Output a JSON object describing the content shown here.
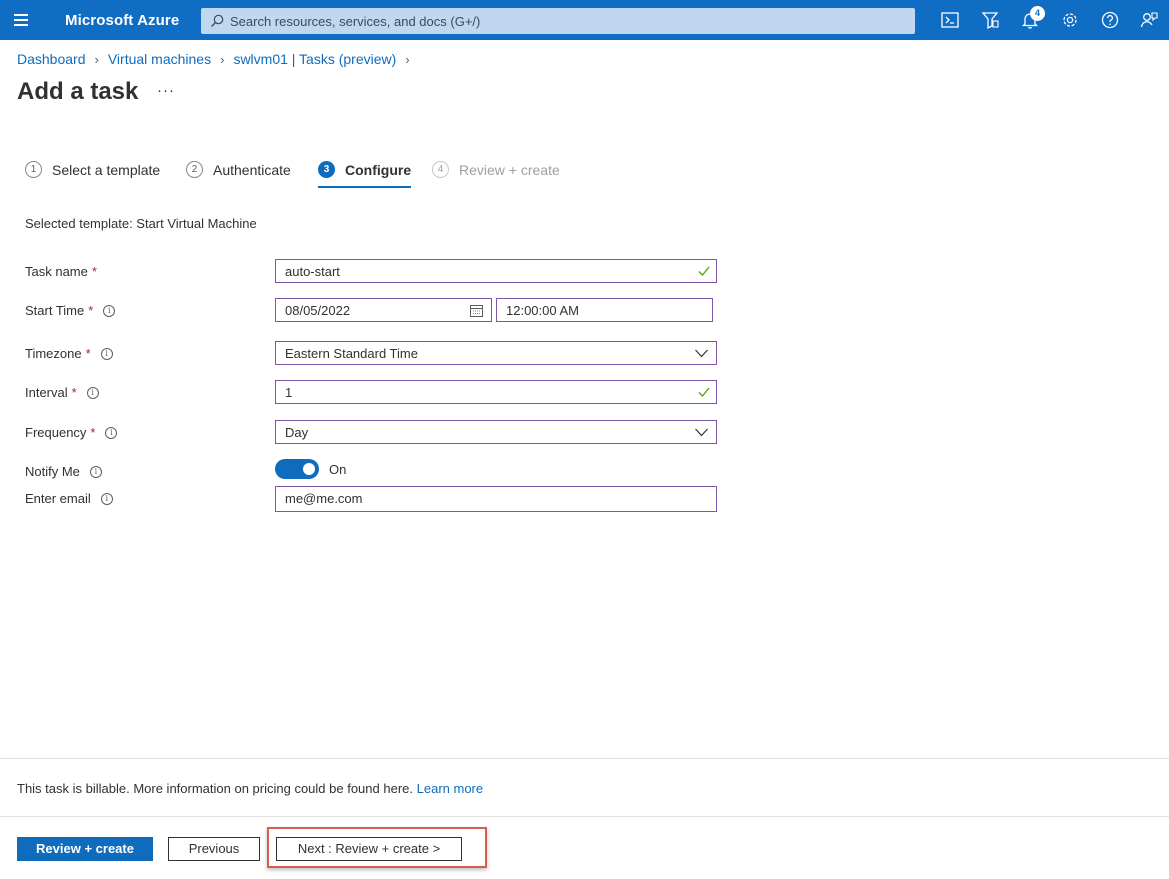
{
  "topbar": {
    "brand": "Microsoft Azure",
    "search_placeholder": "Search resources, services, and docs (G+/)",
    "notification_count": "4",
    "icons": [
      "cloud-shell-icon",
      "directory-filter-icon",
      "bell-icon",
      "gear-icon",
      "help-icon",
      "feedback-icon"
    ],
    "color": "#0f6dc4"
  },
  "breadcrumb": [
    "Dashboard",
    "Virtual machines",
    "swlvm01 | Tasks (preview)"
  ],
  "page": {
    "title": "Add a task",
    "more": "···"
  },
  "steps": [
    {
      "number": "1",
      "label": "Select a template",
      "state": "done"
    },
    {
      "number": "2",
      "label": "Authenticate",
      "state": "done"
    },
    {
      "number": "3",
      "label": "Configure",
      "state": "active"
    },
    {
      "number": "4",
      "label": "Review + create",
      "state": "disabled"
    }
  ],
  "selected_template": "Selected template: Start Virtual Machine",
  "form": {
    "task_name": {
      "label": "Task name",
      "required": "*",
      "value": "auto-start"
    },
    "start_time": {
      "label": "Start Time",
      "required": "*",
      "date": "08/05/2022",
      "time": "12:00:00 AM"
    },
    "timezone": {
      "label": "Timezone",
      "required": "*",
      "value": "Eastern Standard Time"
    },
    "interval": {
      "label": "Interval",
      "required": "*",
      "value": "1"
    },
    "frequency": {
      "label": "Frequency",
      "required": "*",
      "value": "Day"
    },
    "notify_me": {
      "label": "Notify Me",
      "state": "On"
    },
    "email": {
      "label": "Enter email",
      "value": "me@me.com"
    }
  },
  "footer": {
    "billing_text": "This task is billable. More information on pricing could be found here.",
    "learn_more": "Learn more",
    "review_create": "Review + create",
    "previous": "Previous",
    "next": "Next : Review + create >"
  },
  "colors": {
    "accent": "#0f6cbd",
    "required": "#a4262c",
    "field_border": "#7f56a8",
    "highlight": "#dd5b4b"
  }
}
